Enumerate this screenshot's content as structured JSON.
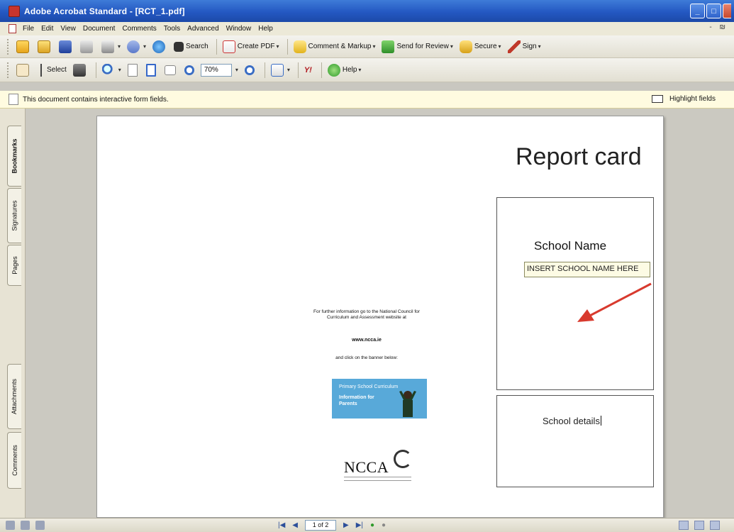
{
  "window": {
    "title": "Adobe Acrobat Standard - [RCT_1.pdf]"
  },
  "menu": [
    "File",
    "Edit",
    "View",
    "Document",
    "Comments",
    "Tools",
    "Advanced",
    "Window",
    "Help"
  ],
  "menu_right": "- ₪",
  "toolbar1": {
    "search_label": "Search",
    "create_pdf_label": "Create PDF",
    "comment_markup_label": "Comment & Markup",
    "send_review_label": "Send for Review",
    "secure_label": "Secure",
    "sign_label": "Sign"
  },
  "toolbar2": {
    "select_label": "Select",
    "zoom_value": "70%",
    "yahoo_label": "Y!",
    "help_label": "Help"
  },
  "infobar": {
    "message": "This document contains interactive form fields.",
    "highlight_label": "Highlight fields"
  },
  "navpanel": {
    "tabs": [
      "Bookmarks",
      "Signatures",
      "Pages",
      "Attachments",
      "Comments"
    ]
  },
  "document": {
    "title": "Report card",
    "school_name_label": "School Name",
    "school_name_field": "INSERT SCHOOL NAME HERE",
    "school_details_label": "School details",
    "info_text": "For further information go to the National Council for Curriculum and Assessment website at",
    "info_url": "www.ncca.ie",
    "info_click": "and click on the banner below:",
    "banner_line1": "Primary School Curriculum",
    "banner_line2": "Information for Parents",
    "logo_text": "NCCA"
  },
  "statusbar": {
    "page_indicator": "1 of 2"
  },
  "colors": {
    "titlebar": "#2458c2",
    "arrow": "#d83a2e",
    "banner": "#58a9d9",
    "form_field_bg": "#fdfbe4"
  }
}
